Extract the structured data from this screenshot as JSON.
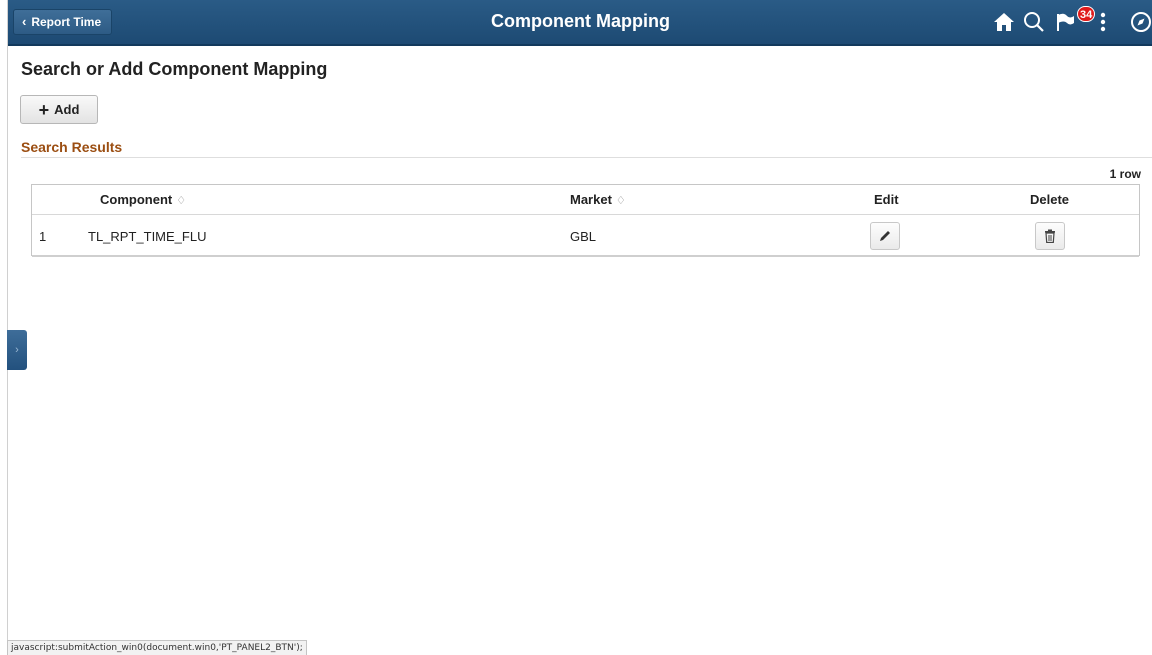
{
  "header": {
    "back_label": "Report Time",
    "title": "Component Mapping",
    "notification_count": "34",
    "icons": [
      "home-icon",
      "search-icon",
      "notification-flag-icon",
      "actions-menu-icon",
      "navbar-compass-icon"
    ]
  },
  "page": {
    "title": "Search or Add Component Mapping",
    "add_label": "Add"
  },
  "results": {
    "section_title": "Search Results",
    "row_count": "1 row",
    "columns": [
      "Component",
      "Market",
      "Edit",
      "Delete"
    ],
    "rows": [
      {
        "num": "1",
        "component": "TL_RPT_TIME_FLU",
        "market": "GBL"
      }
    ]
  },
  "status_bar": {
    "text": "javascript:submitAction_win0(document.win0,'PT_PANEL2_BTN');"
  },
  "colors": {
    "banner": "#1d4a73",
    "section_title": "#9b4e12",
    "badge": "#e01b1b"
  }
}
